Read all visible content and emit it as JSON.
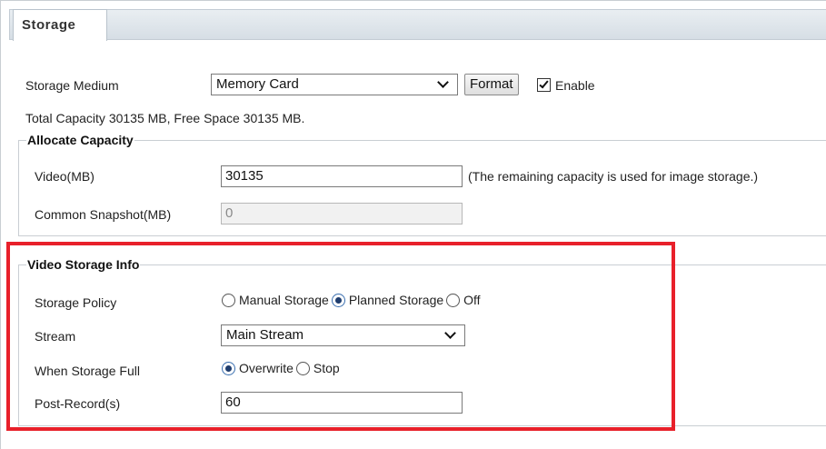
{
  "tab": {
    "title": "Storage"
  },
  "storage_medium": {
    "label": "Storage Medium",
    "value": "Memory Card",
    "format_button": "Format",
    "enable_label": "Enable",
    "enable_checked": true
  },
  "capacity_info": "Total Capacity 30135 MB, Free Space 30135 MB.",
  "allocate": {
    "legend": "Allocate Capacity",
    "video_label": "Video(MB)",
    "video_value": "30135",
    "video_note": "(The remaining capacity is used for image storage.)",
    "snapshot_label": "Common Snapshot(MB)",
    "snapshot_value": "0"
  },
  "video_info": {
    "legend": "Video Storage Info",
    "policy_label": "Storage Policy",
    "policy_options": [
      "Manual Storage",
      "Planned Storage",
      "Off"
    ],
    "policy_selected": "Planned Storage",
    "stream_label": "Stream",
    "stream_value": "Main Stream",
    "full_label": "When Storage Full",
    "full_options": [
      "Overwrite",
      "Stop"
    ],
    "full_selected": "Overwrite",
    "post_record_label": "Post-Record(s)",
    "post_record_value": "60"
  },
  "colors": {
    "highlight": "#e8202a",
    "accent": "#1f3d6e"
  }
}
